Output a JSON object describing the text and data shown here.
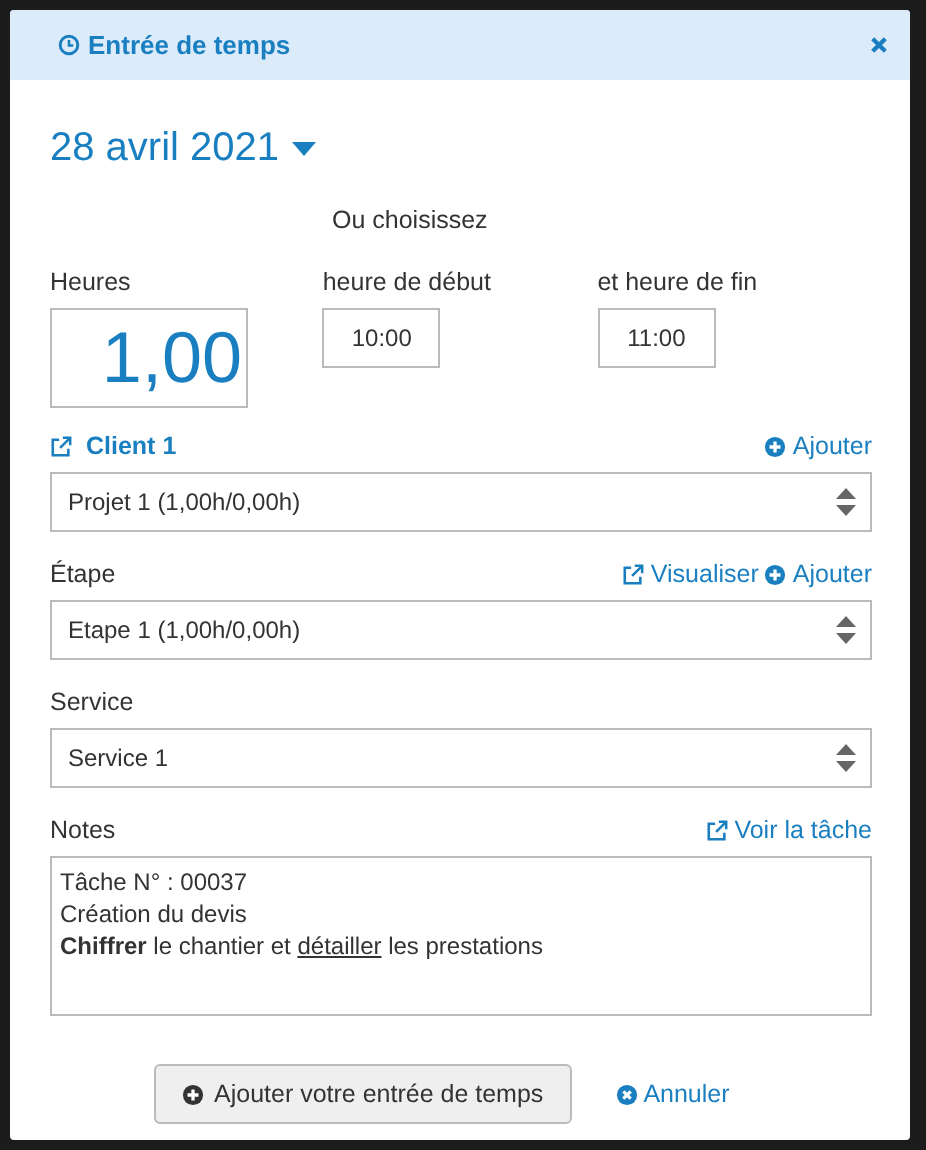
{
  "dialog": {
    "title": "Entrée de temps",
    "date": "28 avril 2021",
    "choose_label": "Ou choisissez",
    "hours": {
      "label": "Heures",
      "value": "1,00"
    },
    "start": {
      "label": "heure de début",
      "value": "10:00"
    },
    "end": {
      "label": "et heure de fin",
      "value": "11:00"
    },
    "client": {
      "name": "Client 1",
      "add": "Ajouter",
      "value": "Projet 1 (1,00h/0,00h)"
    },
    "step": {
      "label": "Étape",
      "view": "Visualiser",
      "add": "Ajouter",
      "value": "Etape 1 (1,00h/0,00h)"
    },
    "service": {
      "label": "Service",
      "value": "Service 1"
    },
    "notes": {
      "label": "Notes",
      "link": "Voir la tâche",
      "lines": [
        [
          {
            "text": "Tâche  N° : 00037",
            "bold": false,
            "underline": false
          }
        ],
        [
          {
            "text": "Création du devis",
            "bold": false,
            "underline": false
          }
        ],
        [
          {
            "text": "Chiffrer",
            "bold": true,
            "underline": false
          },
          {
            "text": " le chantier et ",
            "bold": false,
            "underline": false
          },
          {
            "text": "détailler",
            "bold": false,
            "underline": true
          },
          {
            "text": " les prestations",
            "bold": false,
            "underline": false
          }
        ]
      ]
    },
    "submit": "Ajouter votre entrée de temps",
    "cancel": "Annuler"
  }
}
